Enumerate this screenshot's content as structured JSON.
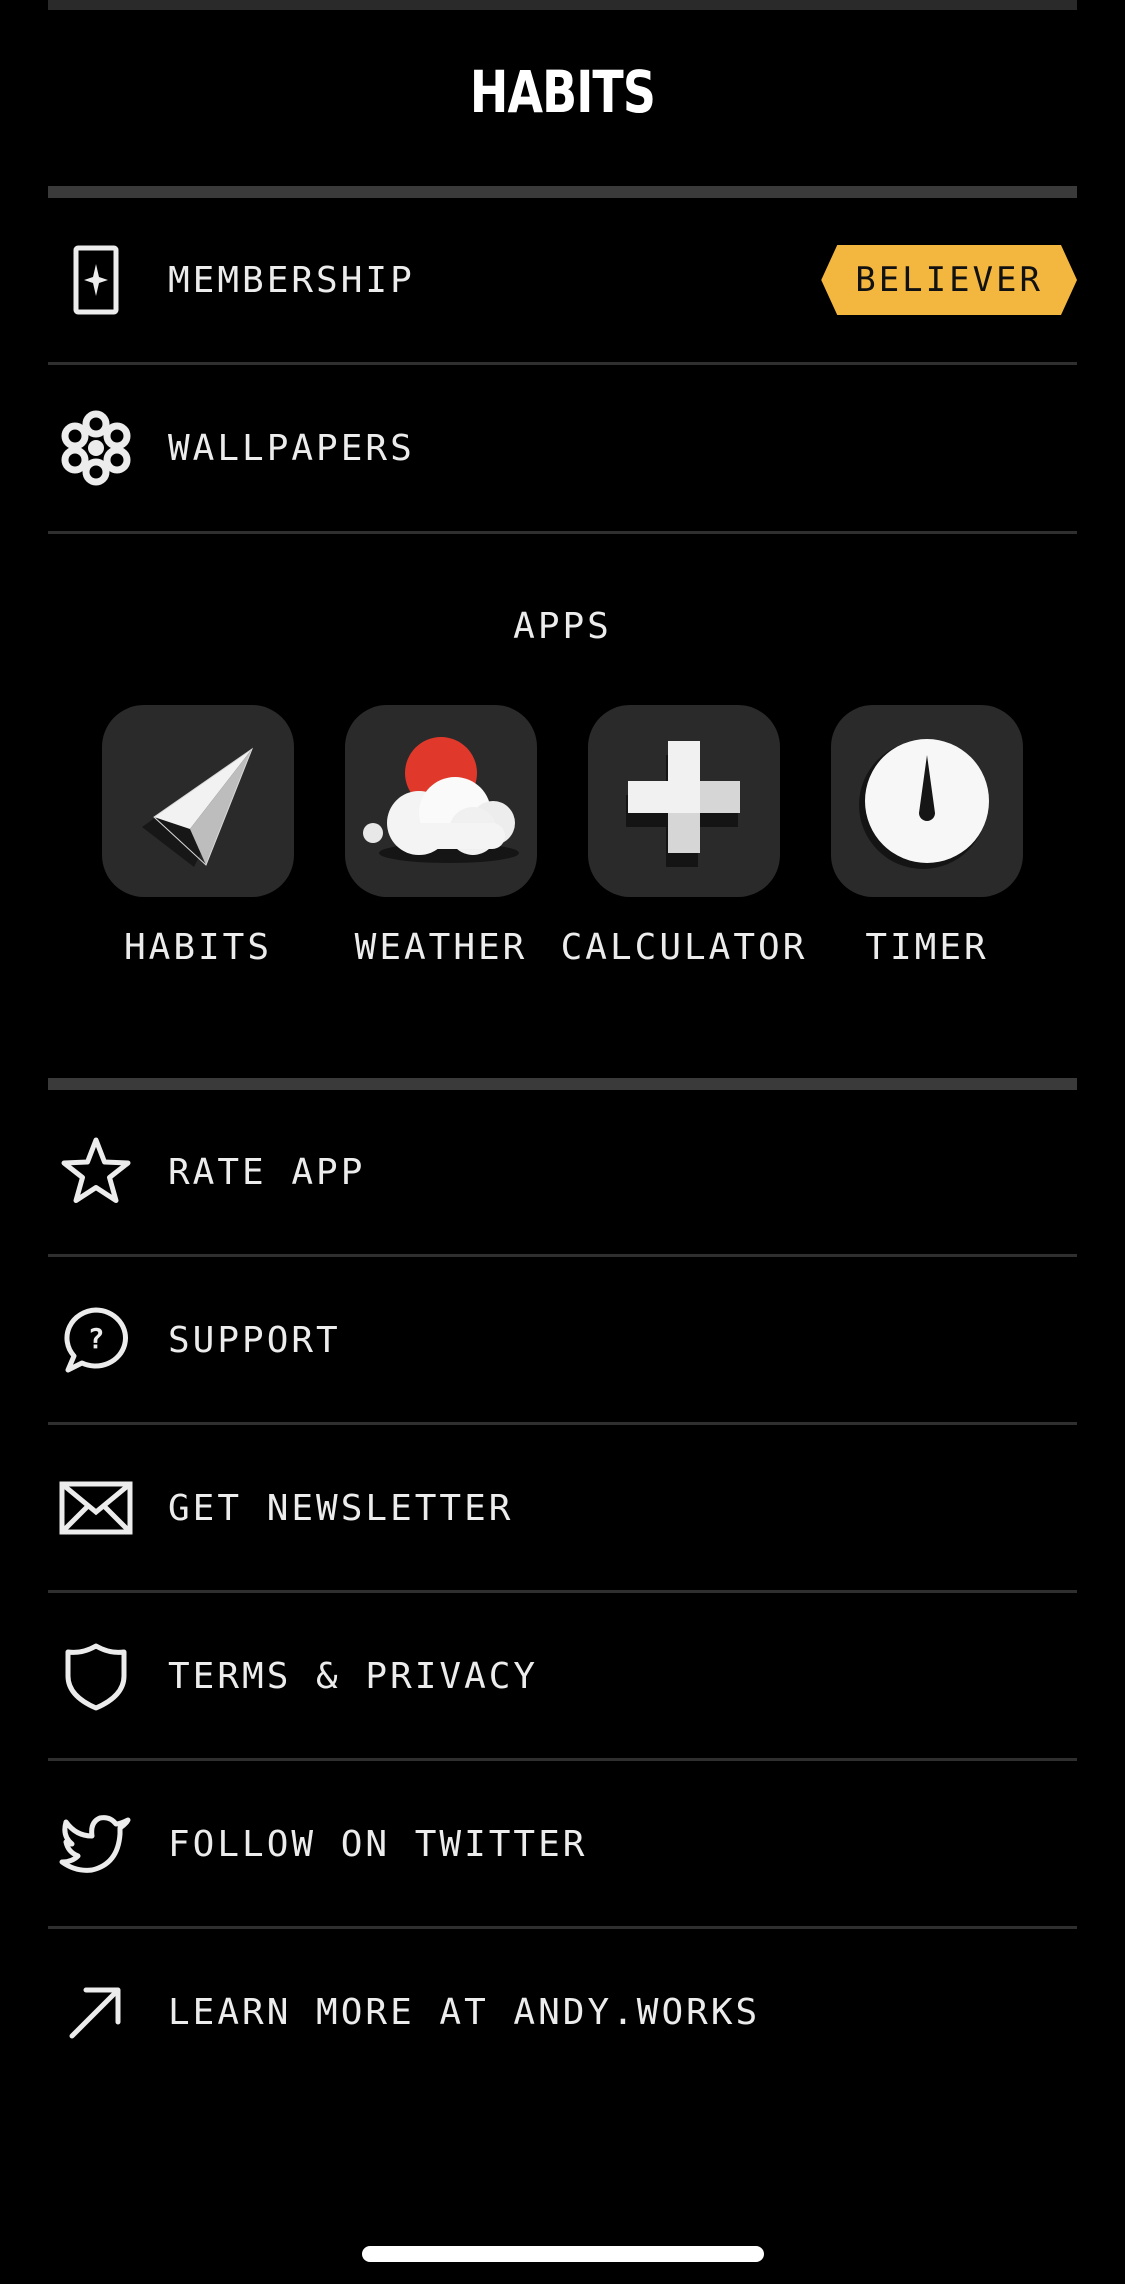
{
  "header": {
    "title": "HABITS"
  },
  "top_menu": [
    {
      "label": "MEMBERSHIP",
      "icon": "membership-card-icon",
      "badge": "BELIEVER"
    },
    {
      "label": "WALLPAPERS",
      "icon": "flower-icon"
    }
  ],
  "apps": {
    "title": "APPS",
    "items": [
      {
        "label": "HABITS",
        "icon": "paper-plane-icon"
      },
      {
        "label": "WEATHER",
        "icon": "cloud-sun-icon"
      },
      {
        "label": "CALCULATOR",
        "icon": "plus-icon"
      },
      {
        "label": "TIMER",
        "icon": "timer-dial-icon"
      }
    ]
  },
  "bottom_menu": [
    {
      "label": "RATE APP",
      "icon": "star-icon"
    },
    {
      "label": "SUPPORT",
      "icon": "question-bubble-icon"
    },
    {
      "label": "GET NEWSLETTER",
      "icon": "envelope-icon"
    },
    {
      "label": "TERMS & PRIVACY",
      "icon": "shield-icon"
    },
    {
      "label": "FOLLOW ON TWITTER",
      "icon": "twitter-bird-icon"
    },
    {
      "label": "LEARN MORE AT ANDY.WORKS",
      "icon": "arrow-up-right-icon"
    }
  ],
  "colors": {
    "background": "#000000",
    "badge": "#F3B73F",
    "accent_red": "#E0392B",
    "tile": "#2A2A2A"
  }
}
